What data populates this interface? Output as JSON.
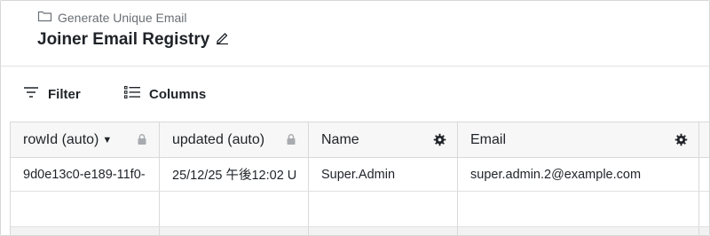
{
  "breadcrumb": {
    "icon": "folder-icon",
    "label": "Generate Unique Email"
  },
  "page": {
    "title": "Joiner Email Registry",
    "edit_icon": "pencil-icon"
  },
  "toolbar": {
    "filter": {
      "label": "Filter",
      "icon": "filter-icon"
    },
    "columns": {
      "label": "Columns",
      "icon": "columns-icon"
    }
  },
  "table": {
    "columns": [
      {
        "label": "rowId (auto)",
        "sort": "descending",
        "icon": "lock-icon"
      },
      {
        "label": "updated (auto)",
        "icon": "lock-icon"
      },
      {
        "label": "Name",
        "icon": "gear-icon"
      },
      {
        "label": "Email",
        "icon": "gear-icon"
      }
    ],
    "rows": [
      {
        "rowId": "9d0e13c0-e189-11f0-",
        "updated": "25/12/25 午後12:02 U",
        "name": "Super.Admin",
        "email": "super.admin.2@example.com"
      }
    ]
  },
  "colors": {
    "header_bg": "#f7f7f7",
    "border": "#d9d9d9",
    "muted_text": "#6a6f75",
    "text": "#1f2328"
  }
}
